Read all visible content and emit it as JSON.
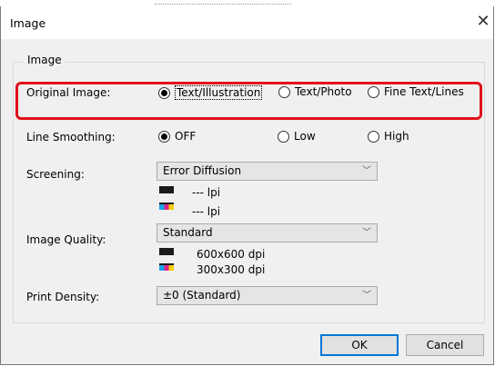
{
  "window": {
    "title": "Image",
    "close_glyph": "✕"
  },
  "group": {
    "label": "Image"
  },
  "original_image": {
    "label": "Original Image:",
    "options": [
      "Text/Illustration",
      "Text/Photo",
      "Fine Text/Lines"
    ],
    "selected": "Text/Illustration"
  },
  "line_smoothing": {
    "label": "Line Smoothing:",
    "options": [
      "OFF",
      "Low",
      "High"
    ],
    "selected": "OFF"
  },
  "screening": {
    "label": "Screening:",
    "value": "Error Diffusion",
    "mono_lpi": "--- lpi",
    "color_lpi": "--- lpi"
  },
  "image_quality": {
    "label": "Image Quality:",
    "value": "Standard",
    "mono_dpi": "600x600 dpi",
    "color_dpi": "300x300 dpi"
  },
  "print_density": {
    "label": "Print Density:",
    "value": "±0 (Standard)"
  },
  "buttons": {
    "ok": "OK",
    "cancel": "Cancel"
  },
  "icons": {
    "chevron": "chevron-down-icon",
    "close": "close-icon"
  },
  "colors": {
    "highlight": "#e0101a",
    "dialog_bg": "#f0f0f0",
    "default_button_border": "#0078d7"
  }
}
